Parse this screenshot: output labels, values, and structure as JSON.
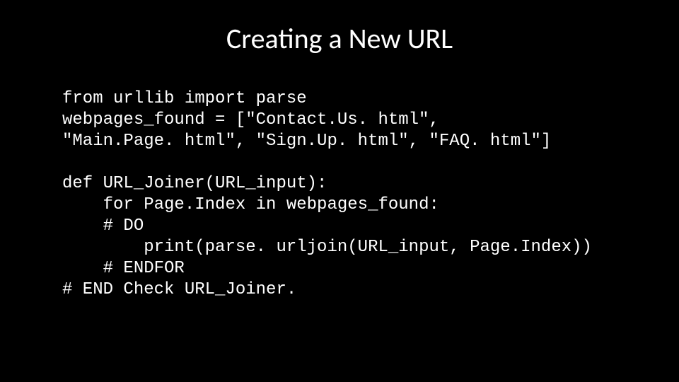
{
  "title": "Creating a New URL",
  "code": {
    "line1": "from urllib import parse",
    "line2": "webpages_found = [\"Contact.Us. html\",",
    "line3": "\"Main.Page. html\", \"Sign.Up. html\", \"FAQ. html\"]",
    "line4": "",
    "line5": "def URL_Joiner(URL_input):",
    "line6": "    for Page.Index in webpages_found:",
    "line7": "    # DO",
    "line8": "        print(parse. urljoin(URL_input, Page.Index))",
    "line9": "    # ENDFOR",
    "line10": "# END Check URL_Joiner."
  }
}
